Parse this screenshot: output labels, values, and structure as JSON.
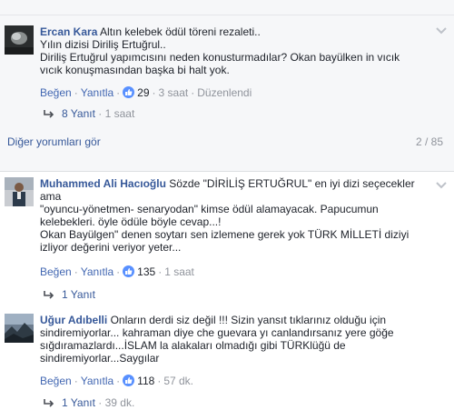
{
  "more_comments": {
    "label": "Diğer yorumları gör",
    "pager": "2 / 85"
  },
  "comments": [
    {
      "author": "Ercan Kara",
      "text": " Altın kelebek ödül töreni rezaleti..\nYılın dizisi Diriliş Ertuğrul..\nDiriliş Ertuğrul yapımcısını neden konusturmadılar? Okan bayülken in vıcık\nvıcık konuşmasından başka bi halt yok.",
      "like_label": "Beğen",
      "reply_label": "Yanıtla",
      "likes": "29",
      "time": "3 saat",
      "edited": "Düzenlendi",
      "replies_label": "8 Yanıt",
      "replies_time": "1 saat"
    },
    {
      "author": "Muhammed Ali Hacıoğlu",
      "text": " Sözde \"DİRİLİŞ ERTUĞRUL\" en iyi dizi seçecekler\nama\n\"oyuncu-yönetmen- senaryodan\" kimse ödül alamayacak. Papucumun\nkelebekleri. öyle ödüle böyle cevap...!\nOkan Bayülgen\" denen soytarı sen izlemene gerek yok TÜRK MİLLETİ diziyi\nizliyor değerini veriyor yeter...",
      "like_label": "Beğen",
      "reply_label": "Yanıtla",
      "likes": "135",
      "time": "1 saat",
      "replies_label": "1 Yanıt"
    },
    {
      "author": "Uğur Adıbelli",
      "text": " Onların derdi siz değil !!! Sizin yansıt tıklarınız olduğu için\nsindiremiyorlar... kahraman diye che guevara yı canlandırsanız yere göğe\nsığdıramazlardı...İSLAM la alakaları olmadığı gibi TÜRKlüğü de\nsindiremiyorlar...Saygılar",
      "like_label": "Beğen",
      "reply_label": "Yanıtla",
      "likes": "118",
      "time": "57 dk.",
      "replies_label": "1 Yanıt",
      "replies_time": "39 dk."
    }
  ],
  "colors": {
    "link": "#365899",
    "action_link": "#4267b2",
    "meta": "#90949c",
    "like_badge": "#5890ff",
    "section_bg": "#f6f7f9"
  }
}
